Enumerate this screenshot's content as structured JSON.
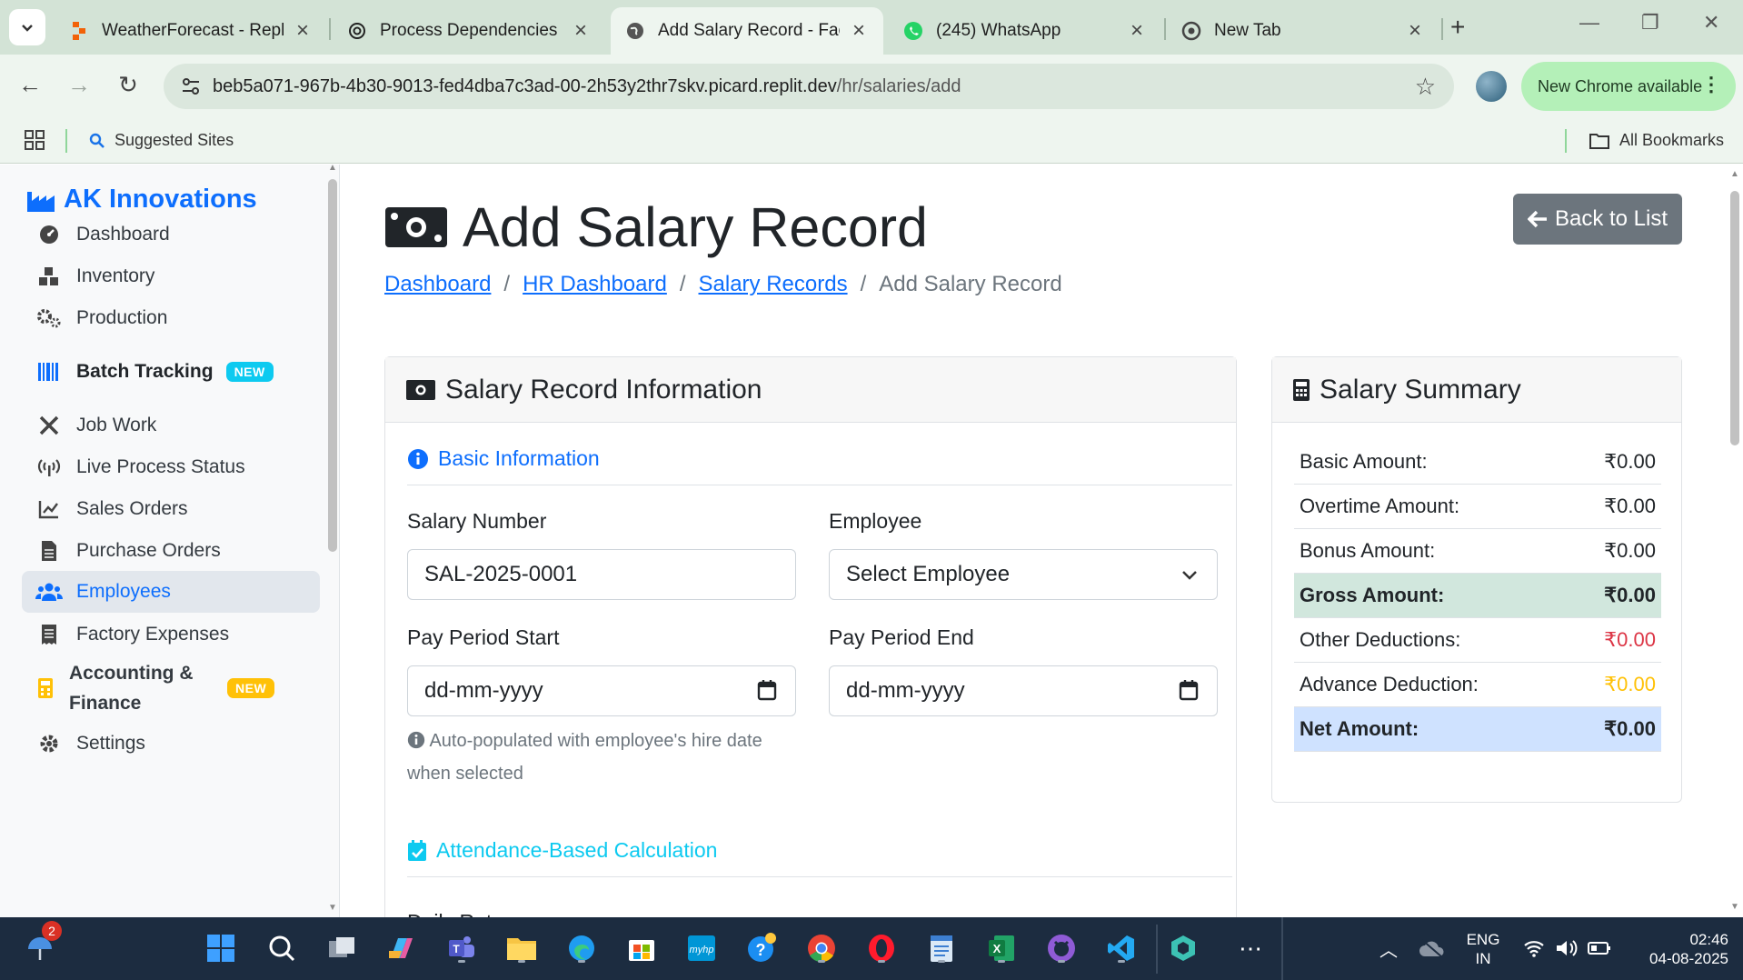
{
  "browser": {
    "tabs": [
      {
        "title": "WeatherForecast - Replit",
        "active": false
      },
      {
        "title": "Process Dependencies O",
        "active": false
      },
      {
        "title": "Add Salary Record - Facto",
        "active": true
      },
      {
        "title": "(245) WhatsApp",
        "active": false
      },
      {
        "title": "New Tab",
        "active": false
      }
    ],
    "url_host": "beb5a071-967b-4b30-9013-fed4dba7c3ad-00-2h53y2thr7skv.picard.replit.dev",
    "url_path": "/hr/salaries/add",
    "update_label": "New Chrome available",
    "bookmarks": {
      "suggested": "Suggested Sites",
      "all": "All Bookmarks"
    }
  },
  "sidebar": {
    "brand": "AK Innovations",
    "items": [
      {
        "label": "Dashboard",
        "icon": "gauge-icon"
      },
      {
        "label": "Inventory",
        "icon": "boxes-icon"
      },
      {
        "label": "Production",
        "icon": "gears-icon"
      },
      {
        "label": "Batch Tracking",
        "icon": "barcode-icon",
        "badge": "NEW"
      },
      {
        "label": "Job Work",
        "icon": "tools-icon"
      },
      {
        "label": "Live Process Status",
        "icon": "broadcast-icon"
      },
      {
        "label": "Sales Orders",
        "icon": "line-chart-icon"
      },
      {
        "label": "Purchase Orders",
        "icon": "document-icon"
      },
      {
        "label": "Employees",
        "icon": "users-icon",
        "active": true
      },
      {
        "label": "Factory Expenses",
        "icon": "receipt-icon"
      },
      {
        "label": "Accounting &",
        "label2": "Finance",
        "icon": "calculator-icon",
        "badge": "NEW"
      },
      {
        "label": "Settings",
        "icon": "gear-icon"
      }
    ]
  },
  "page": {
    "title": "Add Salary Record",
    "breadcrumb": [
      "Dashboard",
      "HR Dashboard",
      "Salary Records",
      "Add Salary Record"
    ],
    "back_button": "Back to List"
  },
  "form": {
    "header": "Salary Record Information",
    "basic_section": "Basic Information",
    "salary_number_label": "Salary Number",
    "salary_number_value": "SAL-2025-0001",
    "employee_label": "Employee",
    "employee_value": "Select Employee",
    "period_start_label": "Pay Period Start",
    "period_start_placeholder": "dd-mm-yyyy",
    "period_end_label": "Pay Period End",
    "period_end_placeholder": "dd-mm-yyyy",
    "hint": "Auto-populated with employee's hire date when selected",
    "attendance_section": "Attendance-Based Calculation",
    "daily_rate_label": "Daily Rate"
  },
  "summary": {
    "header": "Salary Summary",
    "rows": [
      {
        "label": "Basic Amount:",
        "value": "₹0.00",
        "style": "normal"
      },
      {
        "label": "Overtime Amount:",
        "value": "₹0.00",
        "style": "normal"
      },
      {
        "label": "Bonus Amount:",
        "value": "₹0.00",
        "style": "normal"
      },
      {
        "label": "Gross Amount:",
        "value": "₹0.00",
        "style": "gross"
      },
      {
        "label": "Other Deductions:",
        "value": "₹0.00",
        "style": "danger"
      },
      {
        "label": "Advance Deduction:",
        "value": "₹0.00",
        "style": "warning"
      },
      {
        "label": "Net Amount:",
        "value": "₹0.00",
        "style": "net"
      }
    ]
  },
  "taskbar": {
    "notification_count": "2",
    "lang": "ENG",
    "region": "IN",
    "time": "02:46",
    "date": "04-08-2025"
  },
  "colors": {
    "primary": "#0d6efd",
    "info": "#0dcaf0",
    "danger": "#dc3545",
    "warning": "#ffc107",
    "gross_bg": "#d1e7dd",
    "net_bg": "#cfe2ff"
  }
}
